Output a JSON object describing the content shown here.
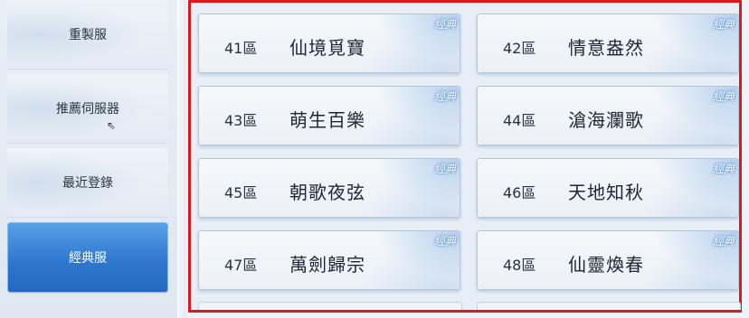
{
  "sidebar": {
    "items": [
      {
        "label": "重製服"
      },
      {
        "label": "推薦伺服器"
      },
      {
        "label": "最近登錄"
      },
      {
        "label": "經典服"
      }
    ]
  },
  "servers": [
    {
      "num": "41區",
      "name": "仙境覓寶",
      "badge": "經典"
    },
    {
      "num": "42區",
      "name": "情意盎然",
      "badge": "經典"
    },
    {
      "num": "43區",
      "name": "萌生百樂",
      "badge": "經典"
    },
    {
      "num": "44區",
      "name": "滄海瀾歌",
      "badge": "經典"
    },
    {
      "num": "45區",
      "name": "朝歌夜弦",
      "badge": "經典"
    },
    {
      "num": "46區",
      "name": "天地知秋",
      "badge": "經典"
    },
    {
      "num": "47區",
      "name": "萬劍歸宗",
      "badge": "經典"
    },
    {
      "num": "48區",
      "name": "仙靈煥春",
      "badge": "經典"
    }
  ],
  "colors": {
    "highlight_frame": "#e0161c",
    "active_tab": "#2f78cf"
  }
}
